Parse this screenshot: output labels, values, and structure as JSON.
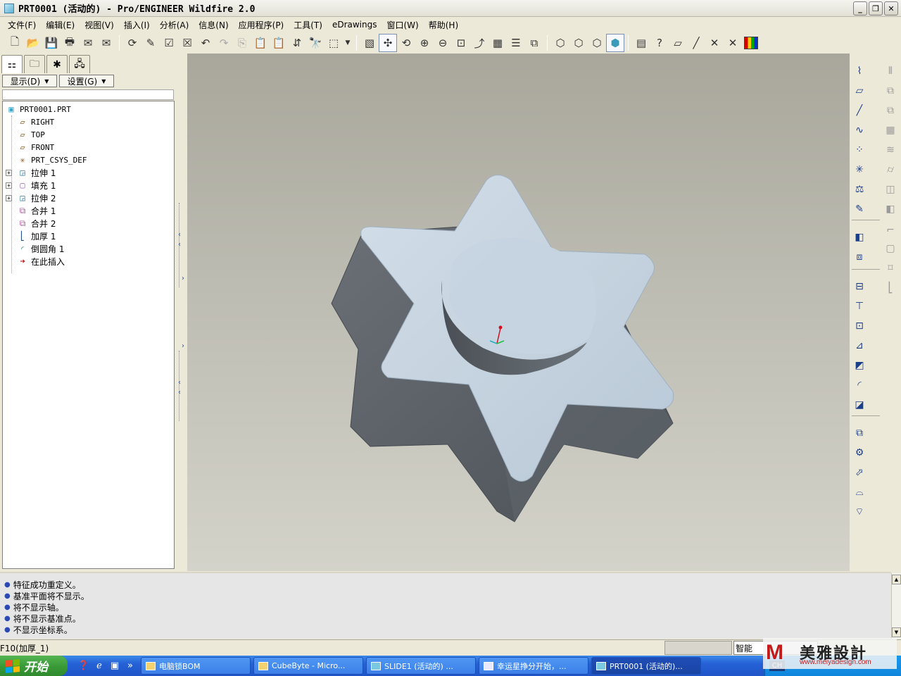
{
  "window": {
    "title": "PRT0001 (活动的) - Pro/ENGINEER Wildfire 2.0",
    "minimize": "_",
    "restore": "❐",
    "close": "✕"
  },
  "menu": [
    "文件(F)",
    "编辑(E)",
    "视图(V)",
    "插入(I)",
    "分析(A)",
    "信息(N)",
    "应用程序(P)",
    "工具(T)",
    "eDrawings",
    "窗口(W)",
    "帮助(H)"
  ],
  "toolbar_icons": [
    "new-icon",
    "open-icon",
    "save-icon",
    "print-icon",
    "send-mail-icon",
    "undo-icon",
    "redo-icon",
    "copy-icon",
    "paste-icon",
    "regenerate-icon",
    "find-icon",
    "select-box-icon",
    "repaint-icon",
    "spin-center-icon",
    "orient-icon",
    "zoom-in-icon",
    "zoom-out-icon",
    "refit-icon",
    "reorient-icon",
    "saved-views-icon",
    "layers-icon",
    "view-manager-icon",
    "wireframe-icon",
    "hidden-line-icon",
    "no-hidden-icon",
    "shading-icon",
    "model-tree-icon",
    "context-help-icon",
    "datum-plane-display-icon",
    "datum-axis-display-icon",
    "datum-point-display-icon",
    "csys-display-icon",
    "appearance-icon"
  ],
  "nav": {
    "show_button": "显示(D)",
    "settings_button": "设置(G)",
    "filter_placeholder": ""
  },
  "model_tree": {
    "root": "PRT0001.PRT",
    "items": [
      {
        "label": "RIGHT",
        "icon": "datum-plane-icon",
        "expandable": false
      },
      {
        "label": "TOP",
        "icon": "datum-plane-icon",
        "expandable": false
      },
      {
        "label": "FRONT",
        "icon": "datum-plane-icon",
        "expandable": false
      },
      {
        "label": "PRT_CSYS_DEF",
        "icon": "csys-icon",
        "expandable": false
      },
      {
        "label": "拉伸 1",
        "icon": "extrude-icon",
        "expandable": true
      },
      {
        "label": "填充 1",
        "icon": "fill-icon",
        "expandable": true
      },
      {
        "label": "拉伸 2",
        "icon": "extrude-icon",
        "expandable": true
      },
      {
        "label": "合并 1",
        "icon": "merge-icon",
        "expandable": false
      },
      {
        "label": "合并 2",
        "icon": "merge-icon",
        "expandable": false
      },
      {
        "label": "加厚 1",
        "icon": "thicken-icon",
        "expandable": false
      },
      {
        "label": "倒圆角 1",
        "icon": "round-icon",
        "expandable": false
      },
      {
        "label": "在此插入",
        "icon": "insert-here-icon",
        "expandable": false
      }
    ]
  },
  "messages": [
    "特征成功重定义。",
    "基准平面将不显示。",
    "将不显示轴。",
    "将不显示基准点。",
    "不显示坐标系。"
  ],
  "status": {
    "text": "F10(加厚_1)",
    "filter_value": "智能"
  },
  "taskbar": {
    "start": "开始",
    "items": [
      "电脑锁BOM",
      "CubeByte - Micro...",
      "SLIDE1 (活动的) ...",
      "幸运星挣分开始，...",
      "PRT0001 (活动的)..."
    ],
    "tray_ime": "CH"
  },
  "watermark": {
    "logo": "M",
    "brand": "美雅設計",
    "url": "www.meiyadesign.com"
  },
  "colors": {
    "model_top_face": "#c6d4e2",
    "model_side_face": "#5b6066",
    "viewport_bg_top": "#a9a79c",
    "viewport_bg_bottom": "#d4d3ca",
    "taskbar_blue": "#2561d6"
  }
}
